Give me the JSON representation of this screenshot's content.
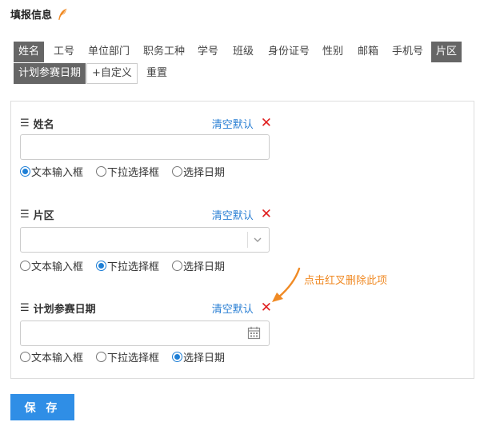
{
  "header": {
    "title": "填报信息",
    "icon": "feather-icon",
    "icon_color": "#f08a24"
  },
  "tags": [
    {
      "label": "姓名",
      "selected": true
    },
    {
      "label": "工号",
      "selected": false
    },
    {
      "label": "单位部门",
      "selected": false
    },
    {
      "label": "职务工种",
      "selected": false
    },
    {
      "label": "学号",
      "selected": false
    },
    {
      "label": "班级",
      "selected": false
    },
    {
      "label": "身份证号",
      "selected": false
    },
    {
      "label": "性别",
      "selected": false
    },
    {
      "label": "邮箱",
      "selected": false
    },
    {
      "label": "手机号",
      "selected": false
    },
    {
      "label": "片区",
      "selected": true
    },
    {
      "label": "计划参赛日期",
      "selected": true
    }
  ],
  "actions": {
    "add_custom": "+自定义",
    "reset": "重置"
  },
  "fields": [
    {
      "name": "姓名",
      "clear_label": "清空默认",
      "input_type": "文本输入框",
      "value": ""
    },
    {
      "name": "片区",
      "clear_label": "清空默认",
      "input_type": "下拉选择框",
      "value": ""
    },
    {
      "name": "计划参赛日期",
      "clear_label": "清空默认",
      "input_type": "选择日期",
      "value": ""
    }
  ],
  "radio_options": [
    "文本输入框",
    "下拉选择框",
    "选择日期"
  ],
  "annotation": {
    "text": "点击红叉删除此项",
    "color": "#f08a24"
  },
  "save_label": "保 存",
  "colors": {
    "accent": "#2f8ee6",
    "delete": "#e02020",
    "tag_selected": "#666666",
    "link": "#2a7fd4"
  }
}
